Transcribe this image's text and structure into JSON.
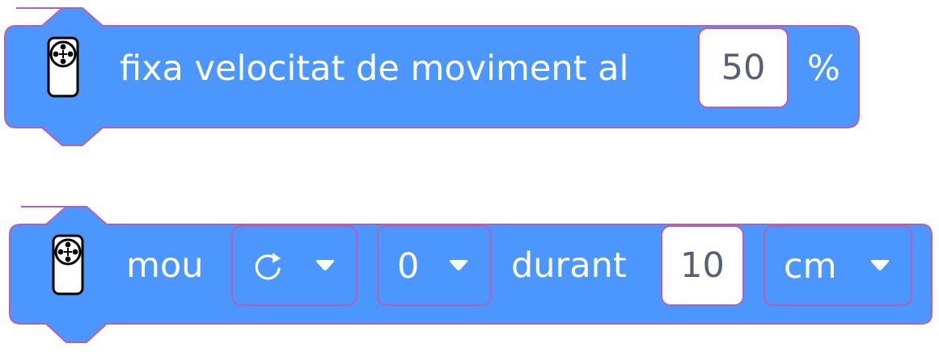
{
  "colors": {
    "block_fill": "#4c97ff",
    "block_stroke": "#b65fb7",
    "text": "#ffffff",
    "input_text": "#575e75"
  },
  "block1": {
    "icon": "remote-controller-icon",
    "label": "fixa velocitat de moviment al",
    "speed_value": "50",
    "unit_label": "%"
  },
  "block2": {
    "icon": "remote-controller-icon",
    "label_move": "mou",
    "direction_icon": "rotate-clockwise-icon",
    "axis_value": "0",
    "label_during": "durant",
    "distance_value": "10",
    "unit_value": "cm"
  }
}
